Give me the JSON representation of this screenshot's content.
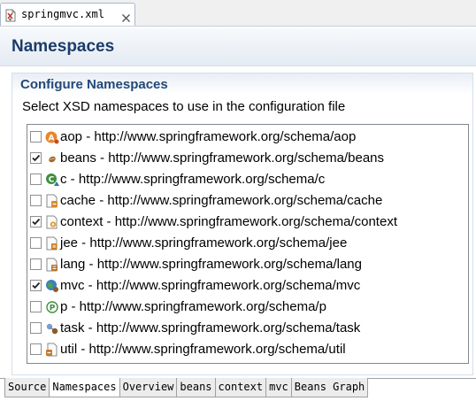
{
  "editor_tab": {
    "filename": "springmvc.xml",
    "close_glyph": "⊠"
  },
  "page": {
    "title": "Namespaces"
  },
  "section": {
    "title": "Configure Namespaces",
    "description": "Select XSD namespaces to use in the configuration file"
  },
  "namespaces": [
    {
      "label": "aop - http://www.springframework.org/schema/aop",
      "checked": false,
      "icon": "aop-icon"
    },
    {
      "label": "beans - http://www.springframework.org/schema/beans",
      "checked": true,
      "icon": "bean-icon"
    },
    {
      "label": "c - http://www.springframework.org/schema/c",
      "checked": false,
      "icon": "c-namespace-icon"
    },
    {
      "label": "cache - http://www.springframework.org/schema/cache",
      "checked": false,
      "icon": "cache-icon"
    },
    {
      "label": "context - http://www.springframework.org/schema/context",
      "checked": true,
      "icon": "context-icon"
    },
    {
      "label": "jee - http://www.springframework.org/schema/jee",
      "checked": false,
      "icon": "jee-icon"
    },
    {
      "label": "lang - http://www.springframework.org/schema/lang",
      "checked": false,
      "icon": "lang-icon"
    },
    {
      "label": "mvc - http://www.springframework.org/schema/mvc",
      "checked": true,
      "icon": "mvc-globe-icon"
    },
    {
      "label": "p - http://www.springframework.org/schema/p",
      "checked": false,
      "icon": "p-namespace-icon"
    },
    {
      "label": "task - http://www.springframework.org/schema/task",
      "checked": false,
      "icon": "task-icon"
    },
    {
      "label": "util - http://www.springframework.org/schema/util",
      "checked": false,
      "icon": "util-icon"
    }
  ],
  "page_tabs": [
    {
      "label": "Source",
      "active": false
    },
    {
      "label": "Namespaces",
      "active": true
    },
    {
      "label": "Overview",
      "active": false
    },
    {
      "label": "beans",
      "active": false
    },
    {
      "label": "context",
      "active": false
    },
    {
      "label": "mvc",
      "active": false
    },
    {
      "label": "Beans Graph",
      "active": false
    }
  ],
  "colors": {
    "title": "#1b3c6a",
    "section_title": "#224979",
    "check_mark": "#1e1e1e"
  }
}
